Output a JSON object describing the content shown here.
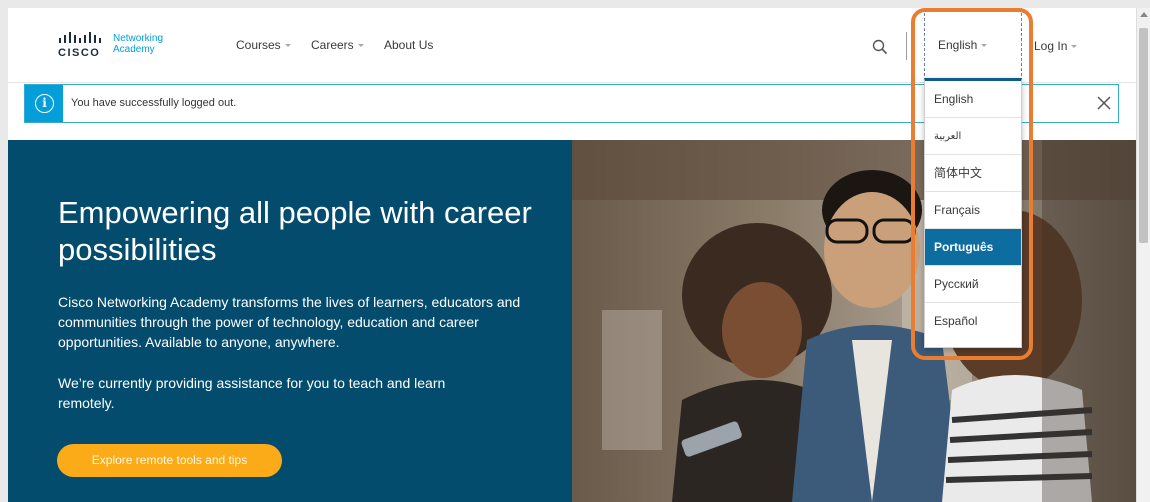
{
  "header": {
    "logo_word": "CISCO",
    "logo_academy_line1": "Networking",
    "logo_academy_line2": "Academy",
    "nav": {
      "courses": "Courses",
      "careers": "Careers",
      "about": "About Us"
    },
    "language_current": "English",
    "login": "Log In"
  },
  "alert": {
    "message": "You have successfully logged out.",
    "icon": "info-icon"
  },
  "hero": {
    "title": "Empowering all people with career possibilities",
    "paragraph1": "Cisco Networking Academy transforms the lives of learners, educators and communities through the power of technology, education and career opportunities. Available to anyone, anywhere.",
    "paragraph2": "We’re currently providing assistance for you to teach and learn remotely.",
    "button": "Explore remote tools and tips"
  },
  "languages": {
    "options": [
      "English",
      "العربية",
      "简体中文",
      "Français",
      "Português",
      "Русский",
      "Español"
    ],
    "active": "Português"
  },
  "colors": {
    "hero_bg": "#034c6e",
    "accent_orange": "#fbab18",
    "info_blue": "#049fd9",
    "highlight": "#e97d32",
    "active_lang": "#0d6ca0"
  }
}
